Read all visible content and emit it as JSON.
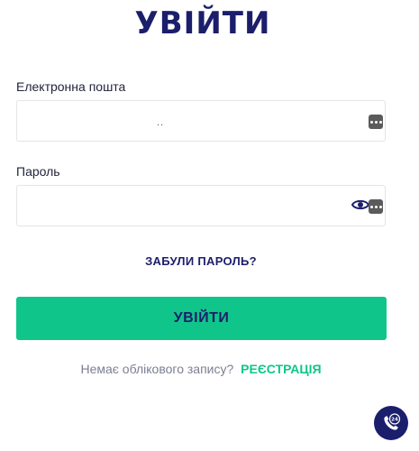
{
  "page": {
    "title": "УВІЙТИ"
  },
  "form": {
    "email_label": "Електронна пошта",
    "email_value": "",
    "email_masked": "..",
    "password_label": "Пароль",
    "password_value": "",
    "forgot_password": "ЗАБУЛИ ПАРОЛЬ?",
    "submit_label": "УВІЙТИ"
  },
  "register": {
    "prompt": "Немає облікового запису?",
    "link_label": "РЕЄСТРАЦІЯ"
  },
  "icons": {
    "autofill": "autofill-dots-icon",
    "password_toggle": "eye-icon",
    "support": "support-24-icon"
  },
  "colors": {
    "primary_navy": "#1b1e6b",
    "accent_green": "#10c58a",
    "muted_text": "#7d7e93"
  }
}
